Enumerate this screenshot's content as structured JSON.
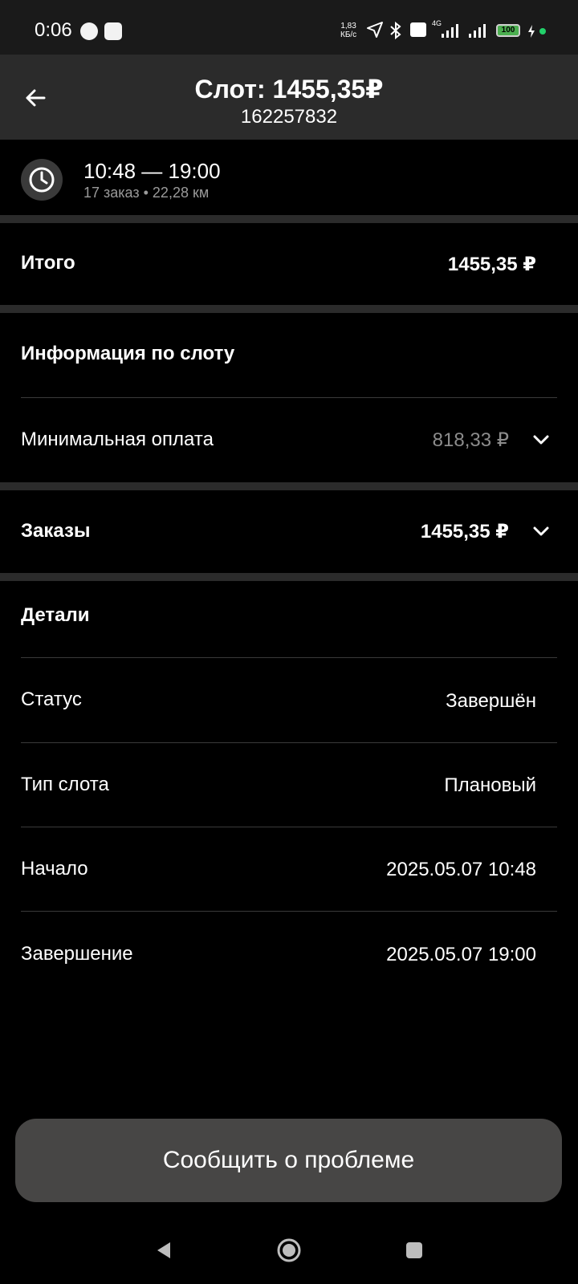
{
  "status_bar": {
    "time": "0:06",
    "net_speed_value": "1,83",
    "net_speed_unit": "КБ/с",
    "network": "4G",
    "battery": "100"
  },
  "header": {
    "title": "Слот: 1455,35₽",
    "slot_id": "162257832"
  },
  "time_block": {
    "range": "10:48 — 19:00",
    "meta": "17 заказ • 22,28 км"
  },
  "total": {
    "label": "Итого",
    "value": "1455,35 ₽"
  },
  "slot_info": {
    "heading": "Информация по слоту",
    "min_payment_label": "Минимальная оплата",
    "min_payment_value": "818,33 ₽"
  },
  "orders": {
    "label": "Заказы",
    "value": "1455,35 ₽"
  },
  "details": {
    "heading": "Детали",
    "rows": [
      {
        "label": "Статус",
        "value": "Завершён"
      },
      {
        "label": "Тип слота",
        "value": "Плановый"
      },
      {
        "label": "Начало",
        "value": "2025.05.07 10:48"
      },
      {
        "label": "Завершение",
        "value": "2025.05.07 19:00"
      }
    ]
  },
  "actions": {
    "report_label": "Сообщить о проблеме"
  },
  "icons": {
    "back": "arrow-left-icon",
    "clock": "clock-icon",
    "chevron": "chevron-down-icon",
    "nav_back": "nav-back-icon",
    "nav_home": "nav-home-icon",
    "nav_recents": "nav-recents-icon"
  },
  "colors": {
    "background": "#000000",
    "header_bg": "#2b2b2b",
    "button_bg": "#474645",
    "muted_text": "#8c8c8c"
  }
}
